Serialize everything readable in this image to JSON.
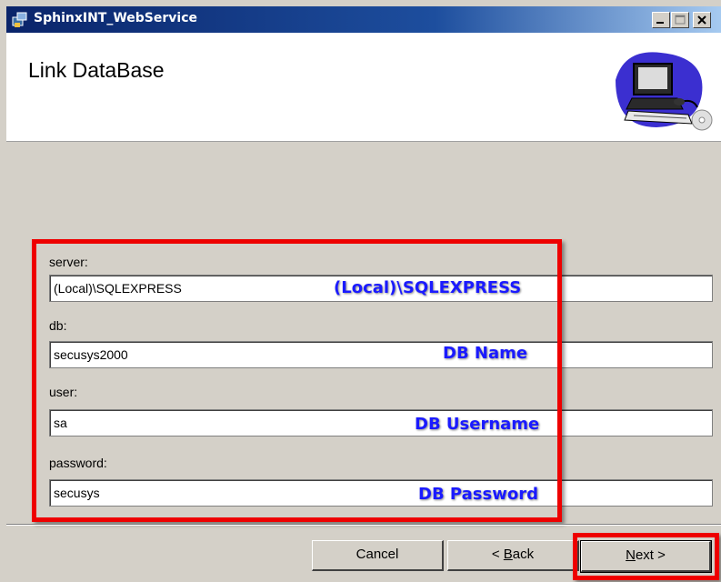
{
  "window": {
    "title": "SphinxINT_WebService",
    "app_icon": "installer-icon"
  },
  "header": {
    "title": "Link DataBase",
    "art": "computer-cd-clipart"
  },
  "form": {
    "server": {
      "label": "server:",
      "value": "(Local)\\SQLEXPRESS",
      "callout": "(Local)\\SQLEXPRESS"
    },
    "db": {
      "label": "db:",
      "value": "secusys2000",
      "callout": "DB Name"
    },
    "user": {
      "label": "user:",
      "value": "sa",
      "callout": "DB Username"
    },
    "password": {
      "label": "password:",
      "value": "secusys",
      "callout": "DB Password"
    }
  },
  "buttons": {
    "cancel": "Cancel",
    "back_mnemonic": "B",
    "back_rest": "ack",
    "next_mnemonic": "N",
    "next_rest": "ext >"
  },
  "colors": {
    "annotation_red": "#ee0000",
    "callout_blue": "#1a1aff",
    "dialog_bg": "#d4d0c8"
  }
}
